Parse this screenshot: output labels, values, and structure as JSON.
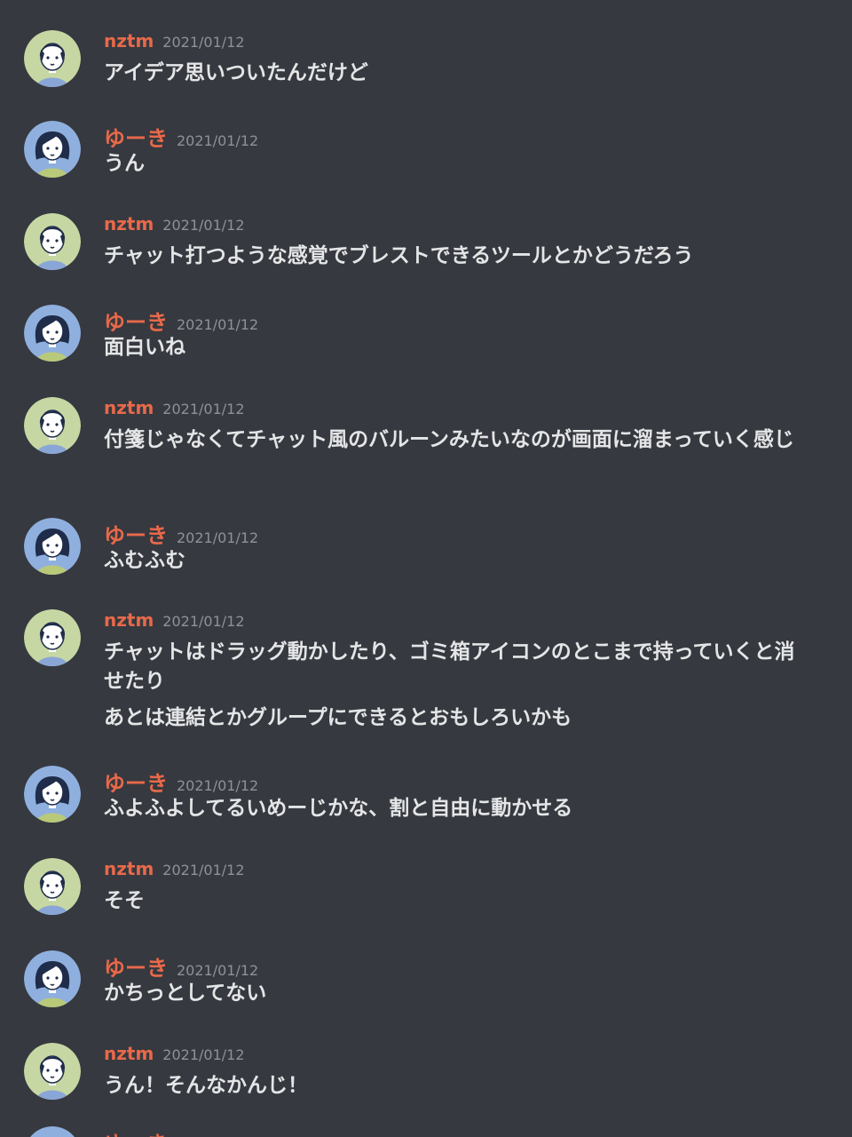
{
  "users": {
    "nztm": {
      "name": "nztm",
      "avatar_icon": "nztm-avatar-icon",
      "avatar_bg": "#c7d7a3"
    },
    "yuki": {
      "name": "ゆーき",
      "avatar_icon": "yuki-avatar-icon",
      "avatar_bg": "#8fb0de"
    }
  },
  "colors": {
    "background": "#36393f",
    "username": "#e8694a",
    "timestamp": "#8e9297",
    "message_text": "#e4e5e6"
  },
  "messages": [
    {
      "author": "nztm",
      "name": "nztm",
      "time": "2021/01/12",
      "lines": [
        "アイデア思いついたんだけど"
      ]
    },
    {
      "author": "yuki",
      "name": "ゆーき",
      "time": "2021/01/12",
      "lines": [
        "うん"
      ]
    },
    {
      "author": "nztm",
      "name": "nztm",
      "time": "2021/01/12",
      "lines": [
        "チャット打つような感覚でブレストできるツールとかどうだろう"
      ]
    },
    {
      "author": "yuki",
      "name": "ゆーき",
      "time": "2021/01/12",
      "lines": [
        "面白いね"
      ]
    },
    {
      "author": "nztm",
      "name": "nztm",
      "time": "2021/01/12",
      "lines": [
        "付箋じゃなくてチャット風のバルーンみたいなのが画面に溜まっていく感じ"
      ]
    },
    {
      "author": "yuki",
      "name": "ゆーき",
      "time": "2021/01/12",
      "lines": [
        "ふむふむ"
      ]
    },
    {
      "author": "nztm",
      "name": "nztm",
      "time": "2021/01/12",
      "lines": [
        "チャットはドラッグ動かしたり、ゴミ箱アイコンのとこまで持っていくと消せたり",
        "あとは連結とかグループにできるとおもしろいかも"
      ]
    },
    {
      "author": "yuki",
      "name": "ゆーき",
      "time": "2021/01/12",
      "lines": [
        "ふよふよしてるいめーじかな、割と自由に動かせる"
      ]
    },
    {
      "author": "nztm",
      "name": "nztm",
      "time": "2021/01/12",
      "lines": [
        "そそ"
      ]
    },
    {
      "author": "yuki",
      "name": "ゆーき",
      "time": "2021/01/12",
      "lines": [
        "かちっとしてない"
      ]
    },
    {
      "author": "nztm",
      "name": "nztm",
      "time": "2021/01/12",
      "lines": [
        "うん！そんなかんじ！"
      ]
    },
    {
      "author": "yuki",
      "name": "ゆーき",
      "time": "",
      "lines": []
    }
  ]
}
